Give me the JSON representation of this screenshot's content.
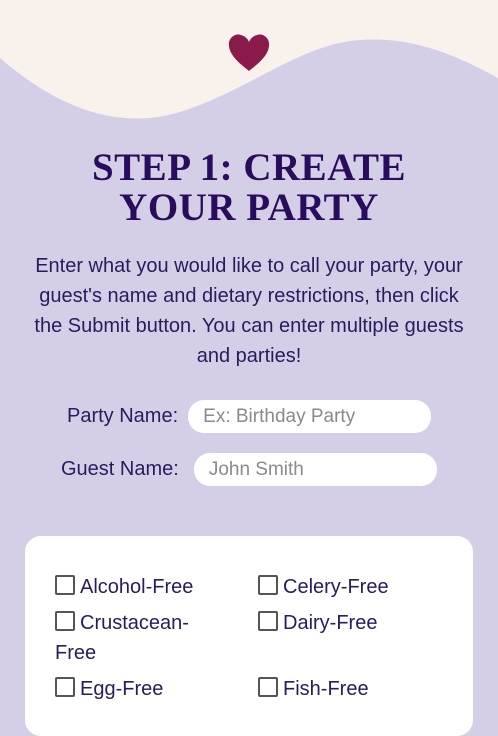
{
  "header": {
    "icon": "heart-icon",
    "wave_top_color": "#f8f1ec",
    "heart_color": "#8a1a4a"
  },
  "title": {
    "line1": "STEP 1: CREATE",
    "line2": "YOUR PARTY"
  },
  "intro_text": "Enter what you would like to call your party, your guest's name and dietary restrictions, then click the Submit button. You can enter multiple guests and parties!",
  "form": {
    "party_label": "Party Name:",
    "party_placeholder": "Ex: Birthday Party",
    "guest_label": "Guest Name:",
    "guest_placeholder": "John Smith"
  },
  "restrictions": [
    {
      "label": "Alcohol-Free",
      "checked": false
    },
    {
      "label": "Celery-Free",
      "checked": false
    },
    {
      "label": "Crustacean-Free",
      "checked": false
    },
    {
      "label": "Dairy-Free",
      "checked": false
    },
    {
      "label": "Egg-Free",
      "checked": false
    },
    {
      "label": "Fish-Free",
      "checked": false
    }
  ],
  "colors": {
    "background": "#d4cfe7",
    "title": "#2a0c5c",
    "text": "#2a1a5e",
    "card": "#ffffff"
  }
}
